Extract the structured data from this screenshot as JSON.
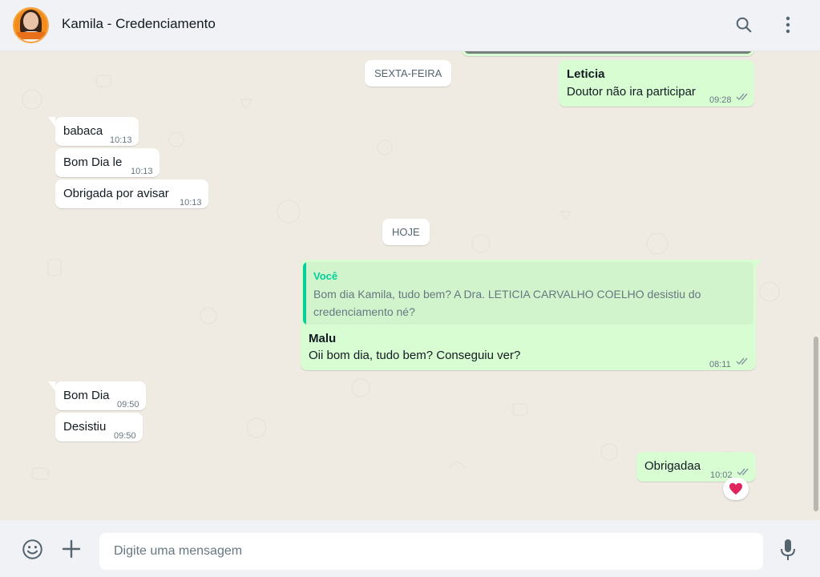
{
  "header": {
    "contact_name": "Kamila - Credenciamento",
    "search_icon": "search-icon",
    "menu_icon": "kebab-menu-icon"
  },
  "colors": {
    "incoming_bubble": "#ffffff",
    "outgoing_bubble": "#d9fdd3",
    "quote_accent": "#06cf9c",
    "read_ticks": "#53bdeb",
    "chat_background": "#efeae2"
  },
  "chat": {
    "date_chips": [
      "SEXTA-FEIRA",
      "HOJE"
    ],
    "messages": [
      {
        "dir": "out",
        "sender": "Leticia",
        "text": "Doutor não ira participar",
        "time": "09:28",
        "status": "read"
      },
      {
        "dir": "in",
        "text": "babaca",
        "time": "10:13"
      },
      {
        "dir": "in",
        "text": "Bom Dia le",
        "time": "10:13"
      },
      {
        "dir": "in",
        "text": "Obrigada por avisar",
        "time": "10:13"
      },
      {
        "dir": "out",
        "quoted": {
          "author": "Você",
          "text": "Bom dia Kamila, tudo bem? A Dra. LETICIA CARVALHO COELHO desistiu do credenciamento né?"
        },
        "sender": "Malu",
        "text": "Oii bom dia, tudo bem? Conseguiu ver?",
        "time": "08:11",
        "status": "read"
      },
      {
        "dir": "in",
        "text": "Bom Dia",
        "time": "09:50"
      },
      {
        "dir": "in",
        "text": "Desistiu",
        "time": "09:50"
      },
      {
        "dir": "out",
        "text": "Obrigadaa",
        "time": "10:02",
        "status": "read",
        "reaction": "heart-emoji"
      }
    ]
  },
  "footer": {
    "placeholder": "Digite uma mensagem",
    "emoji_icon": "emoji-icon",
    "attach_icon": "plus-icon",
    "mic_icon": "microphone-icon"
  }
}
